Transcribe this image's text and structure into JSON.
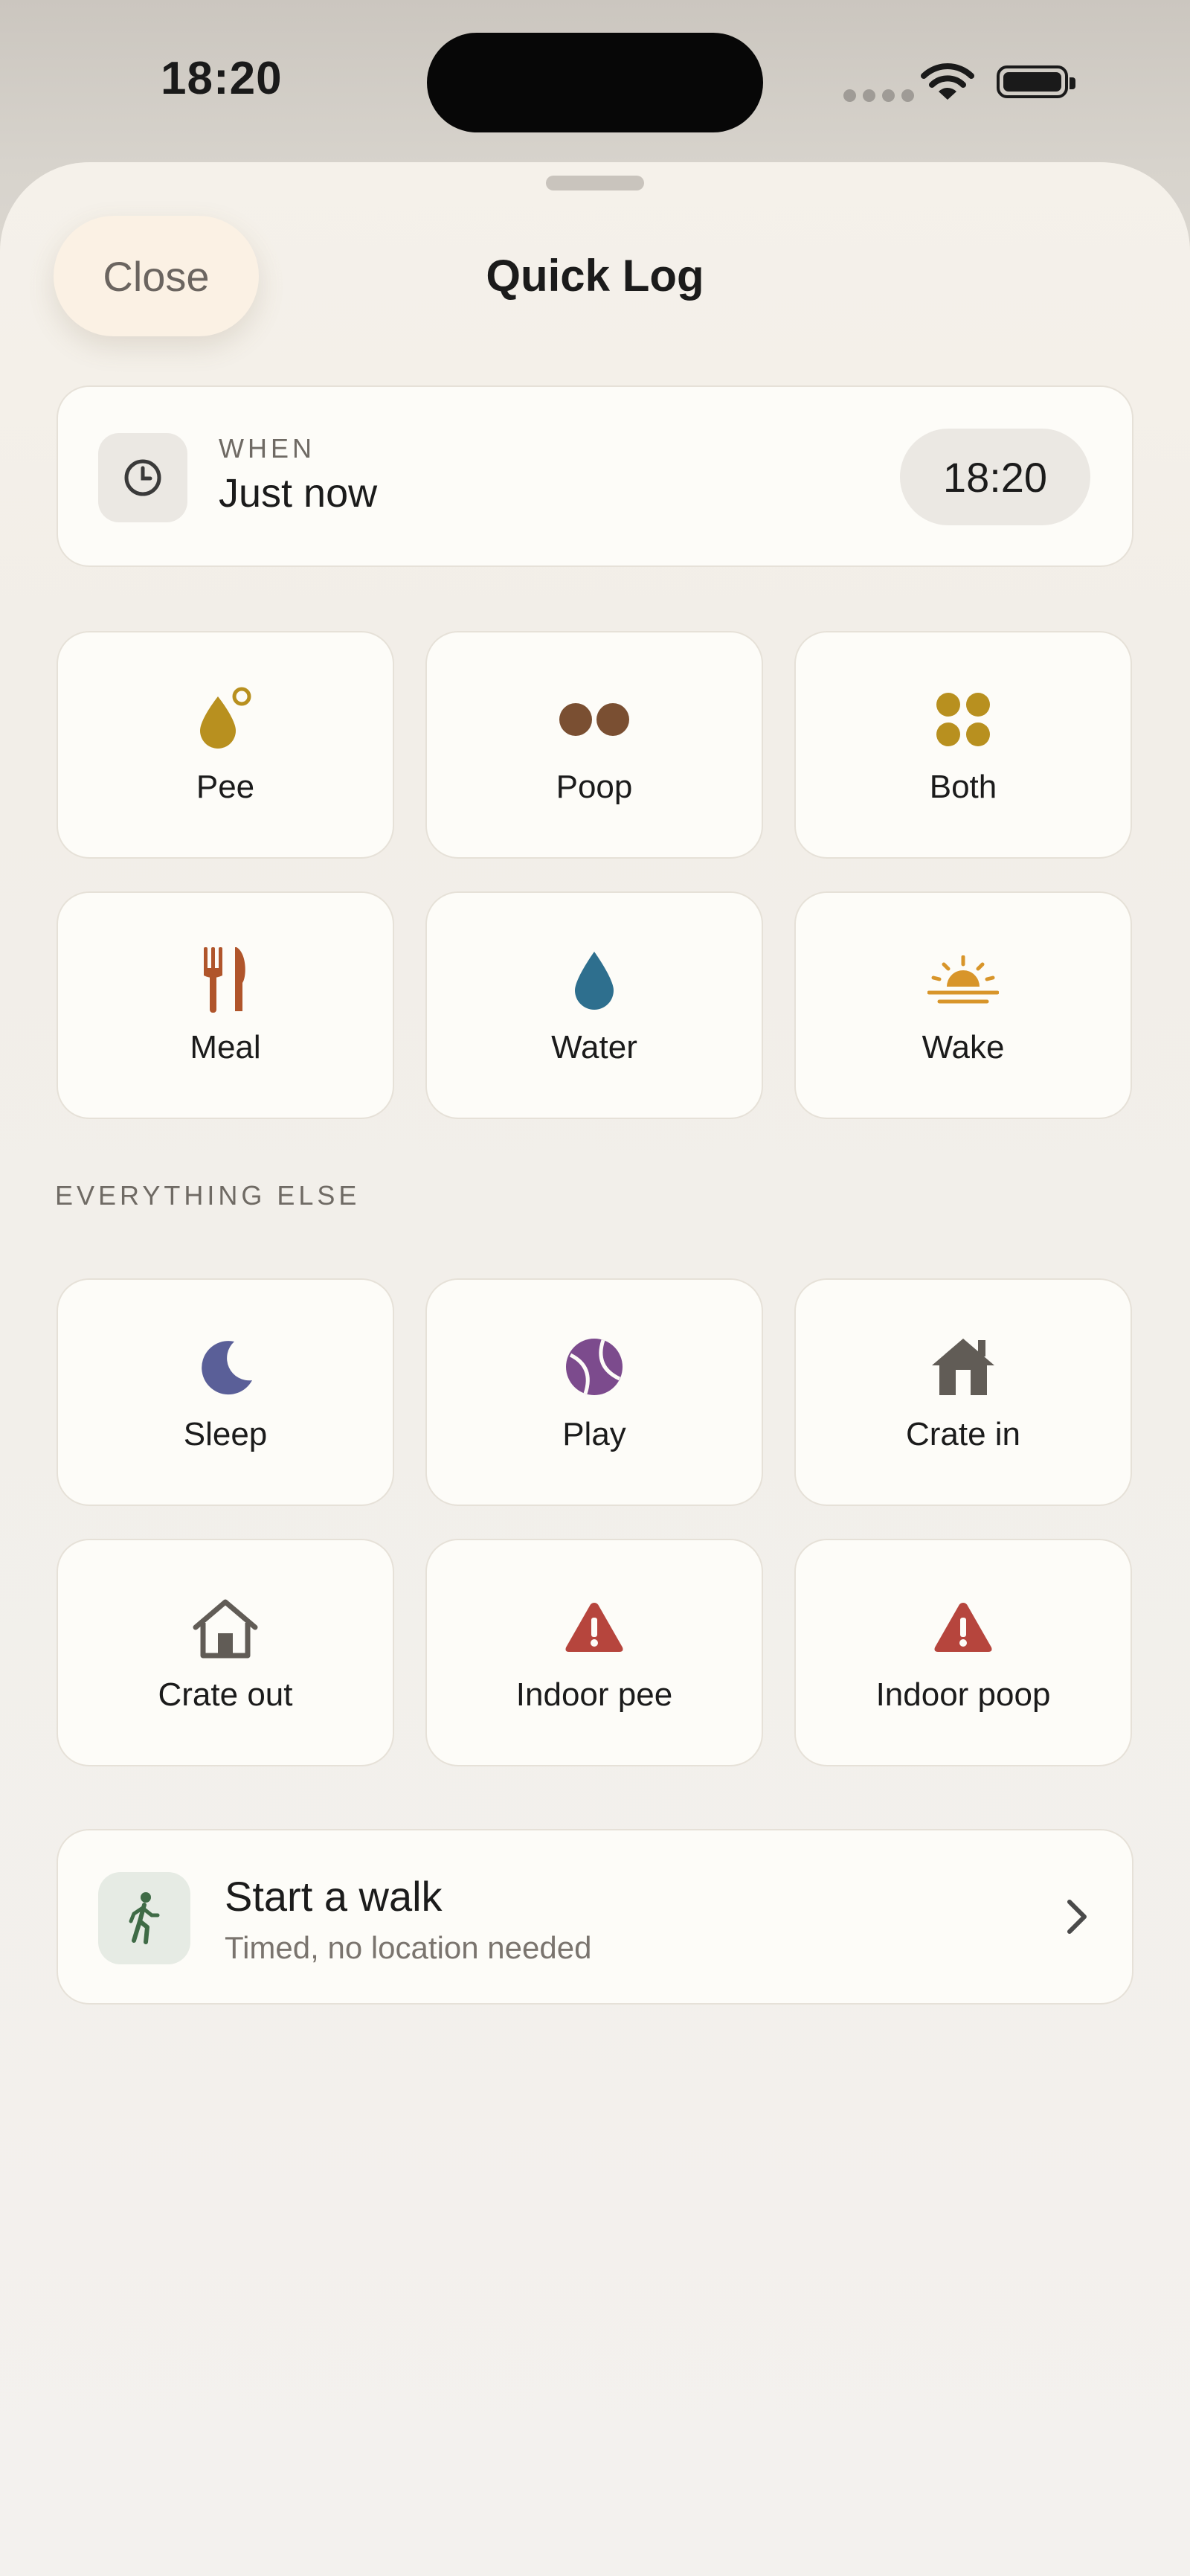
{
  "status_bar": {
    "time": "18:20"
  },
  "sheet": {
    "title": "Quick Log",
    "close_label": "Close"
  },
  "when": {
    "label": "WHEN",
    "value": "Just now",
    "time": "18:20"
  },
  "quick_actions": [
    {
      "label": "Pee",
      "icon": "pee-drop-icon",
      "color": "#b8901f"
    },
    {
      "label": "Poop",
      "icon": "poop-icon",
      "color": "#7a4f32"
    },
    {
      "label": "Both",
      "icon": "both-icon",
      "color": "#b8901f"
    },
    {
      "label": "Meal",
      "icon": "fork-knife-icon",
      "color": "#b0552b"
    },
    {
      "label": "Water",
      "icon": "water-drop-icon",
      "color": "#2e6f8e"
    },
    {
      "label": "Wake",
      "icon": "sunrise-icon",
      "color": "#d8952a"
    }
  ],
  "everything_else": {
    "label": "EVERYTHING ELSE",
    "items": [
      {
        "label": "Sleep",
        "icon": "moon-icon",
        "color": "#5a5f98"
      },
      {
        "label": "Play",
        "icon": "ball-icon",
        "color": "#7c4b8d"
      },
      {
        "label": "Crate in",
        "icon": "house-filled-icon",
        "color": "#615c56"
      },
      {
        "label": "Crate out",
        "icon": "house-outline-icon",
        "color": "#615c56"
      },
      {
        "label": "Indoor pee",
        "icon": "warning-icon",
        "color": "#b6453d"
      },
      {
        "label": "Indoor poop",
        "icon": "warning-icon",
        "color": "#b6453d"
      }
    ]
  },
  "walk": {
    "title": "Start a walk",
    "subtitle": "Timed, no location needed"
  }
}
